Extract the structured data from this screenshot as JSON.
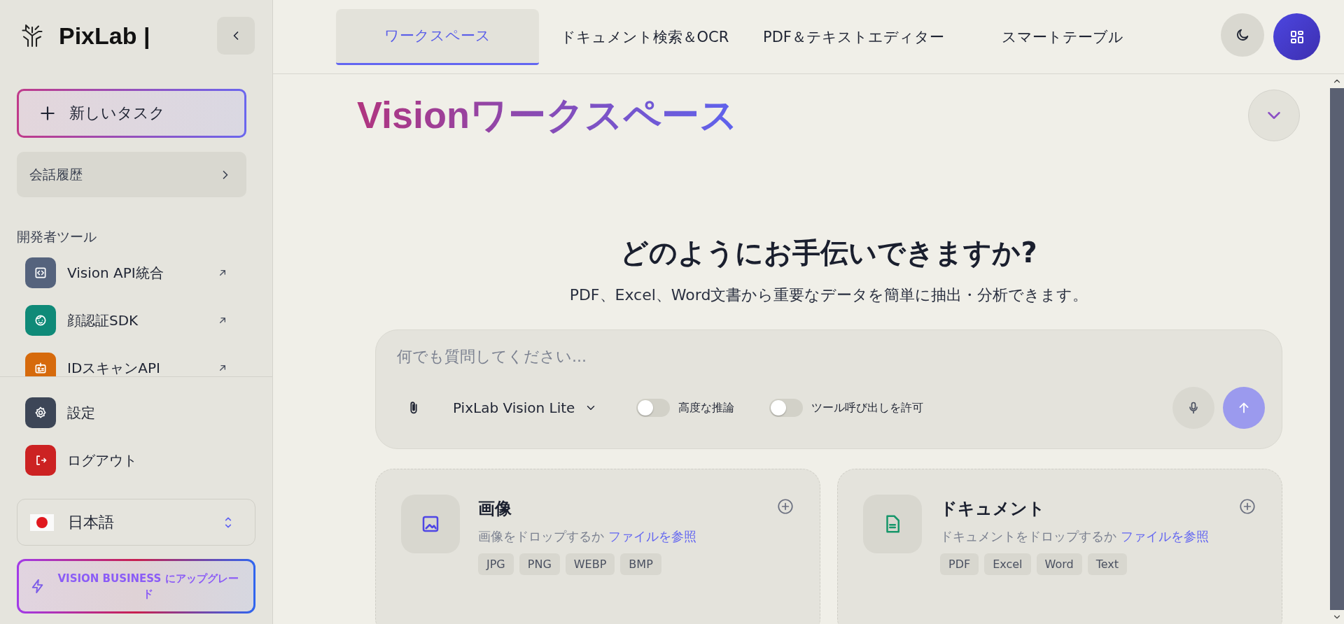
{
  "sidebar": {
    "logo": "PixLab |",
    "new_task": "新しいタスク",
    "history": "会話履歴",
    "section_title": "開発者ツール",
    "tools": [
      {
        "label": "Vision API統合",
        "kind": "code",
        "color": "#55637d"
      },
      {
        "label": "顔認証SDK",
        "kind": "face",
        "color": "#0f8a78"
      },
      {
        "label": "IDスキャンAPI",
        "kind": "id",
        "color": "#d66a0c"
      }
    ],
    "bottom_items": [
      {
        "label": "設定",
        "kind": "settings",
        "color": "#3d4657"
      },
      {
        "label": "ログアウト",
        "kind": "logout",
        "color": "#cc2222"
      }
    ],
    "language": "日本語",
    "upgrade": "VISION BUSINESS にアップグレード"
  },
  "tabs": [
    {
      "label": "ワークスペース",
      "selected": true
    },
    {
      "label": "ドキュメント検索＆OCR",
      "selected": false
    },
    {
      "label": "PDF＆テキストエディター",
      "selected": false
    },
    {
      "label": "スマートテーブル",
      "selected": false
    }
  ],
  "heading": {
    "brand": "Vision",
    "rest": "ワークスペース"
  },
  "hero": {
    "title": "どのようにお手伝いできますか?",
    "subtitle": "PDF、Excel、Word文書から重要なデータを簡単に抽出・分析できます。"
  },
  "composer": {
    "placeholder": "何でも質問してください...",
    "model": "PixLab Vision Lite",
    "toggles": [
      {
        "label": "高度な推論",
        "on": false
      },
      {
        "label": "ツール呼び出しを許可",
        "on": false
      }
    ]
  },
  "cards": [
    {
      "kind": "image",
      "title": "画像",
      "hint": "画像をドロップするか",
      "link": "ファイルを参照",
      "formats": [
        "JPG",
        "PNG",
        "WEBP",
        "BMP"
      ]
    },
    {
      "kind": "document",
      "title": "ドキュメント",
      "hint": "ドキュメントをドロップするか",
      "link": "ファイルを参照",
      "formats": [
        "PDF",
        "Excel",
        "Word",
        "Text"
      ]
    }
  ]
}
